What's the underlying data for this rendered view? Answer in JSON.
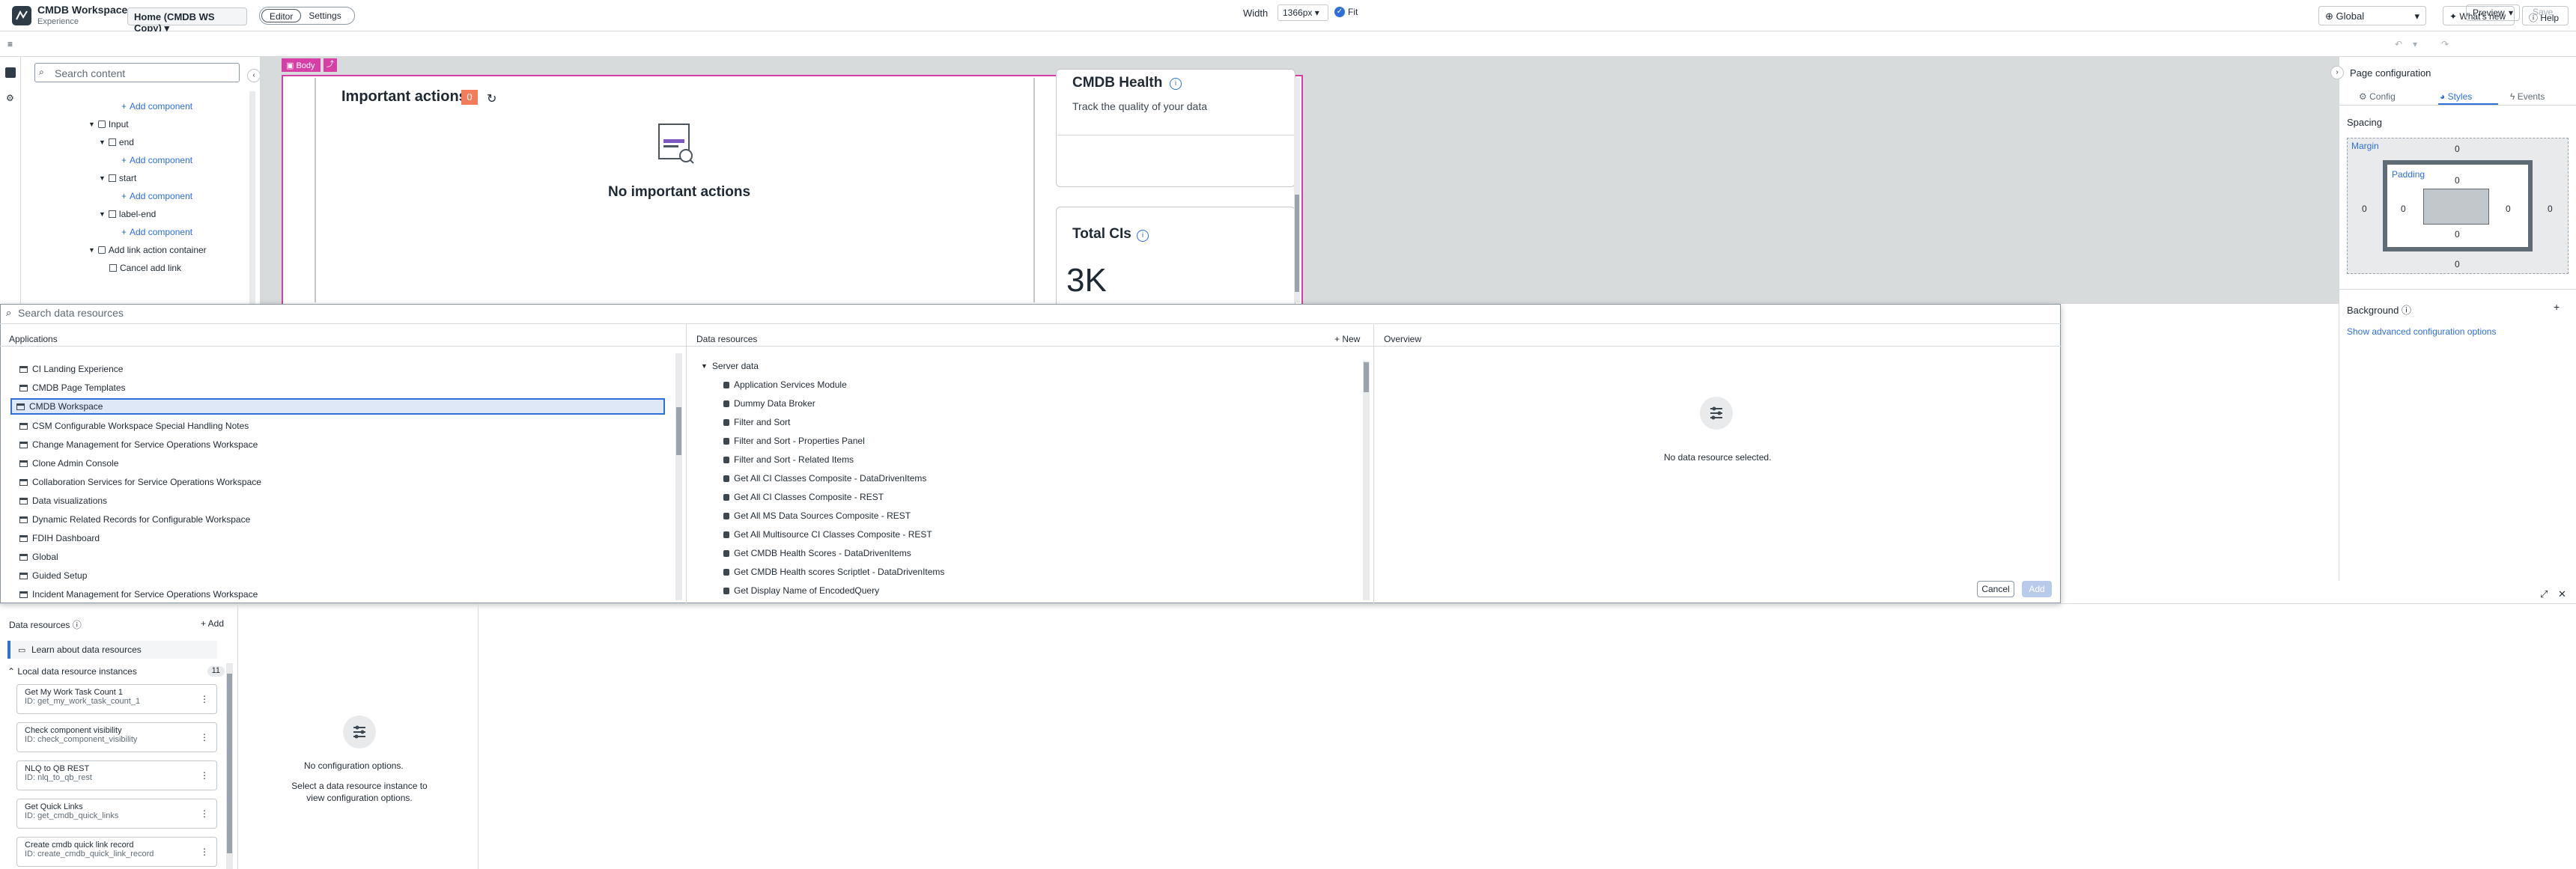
{
  "header": {
    "app_title": "CMDB Workspace",
    "app_subtitle": "Experience",
    "page_select": "Home (CMDB WS Copy)",
    "mode_editor": "Editor",
    "mode_settings": "Settings",
    "scope": "Global",
    "whats_new": "What's new",
    "help": "Help"
  },
  "toolbar": {
    "width_label": "Width",
    "width_value": "1366px",
    "fit_label": "Fit",
    "preview": "Preview",
    "save": "Save"
  },
  "left_panel": {
    "search_placeholder": "Search content",
    "tree": [
      {
        "label": "Add component",
        "kind": "add"
      },
      {
        "label": "Input",
        "kind": "node"
      },
      {
        "label": "end",
        "kind": "leaf"
      },
      {
        "label": "Add component",
        "kind": "add"
      },
      {
        "label": "start",
        "kind": "leaf"
      },
      {
        "label": "Add component",
        "kind": "add"
      },
      {
        "label": "label-end",
        "kind": "leaf"
      },
      {
        "label": "Add component",
        "kind": "add"
      },
      {
        "label": "Add link action container",
        "kind": "node"
      },
      {
        "label": "Cancel add link",
        "kind": "leaf"
      }
    ]
  },
  "canvas": {
    "body_tag": "Body",
    "important_actions_title": "Important actions",
    "important_actions_count": "0",
    "no_important_actions": "No important actions",
    "health_title": "CMDB Health",
    "health_subtitle": "Track the quality of your data",
    "total_cis_title": "Total CIs",
    "total_cis_value": "3K"
  },
  "right_panel": {
    "title": "Page configuration",
    "tabs": [
      "Config",
      "Styles",
      "Events"
    ],
    "active_tab": "Styles",
    "spacing_label": "Spacing",
    "margin_label": "Margin",
    "padding_label": "Padding",
    "margin_values": [
      "0",
      "0",
      "0",
      "0"
    ],
    "padding_values": [
      "0",
      "0",
      "0",
      "0"
    ],
    "background_label": "Background",
    "advanced_link": "Show advanced configuration options"
  },
  "data_modal": {
    "search_placeholder": "Search data resources",
    "applications_header": "Applications",
    "resources_header": "Data resources",
    "new_label": "+ New",
    "overview_header": "Overview",
    "applications": [
      "CI Landing Experience",
      "CMDB Page Templates",
      "CMDB Workspace",
      "CSM Configurable Workspace Special Handling Notes",
      "Change Management for Service Operations Workspace",
      "Clone Admin Console",
      "Collaboration Services for Service Operations Workspace",
      "Data visualizations",
      "Dynamic Related Records for Configurable Workspace",
      "FDIH Dashboard",
      "Global",
      "Guided Setup",
      "Incident Management for Service Operations Workspace"
    ],
    "selected_application": "CMDB Workspace",
    "server_data_label": "Server data",
    "resources": [
      "Application Services Module",
      "Dummy Data Broker",
      "Filter and Sort",
      "Filter and Sort - Properties Panel",
      "Filter and Sort - Related Items",
      "Get All CI Classes Composite - DataDrivenItems",
      "Get All CI Classes Composite - REST",
      "Get All MS Data Sources Composite - REST",
      "Get All Multisource CI Classes Composite - REST",
      "Get CMDB Health Scores - DataDrivenItems",
      "Get CMDB Health scores Scriptlet - DataDrivenItems",
      "Get Display Name of EncodedQuery"
    ],
    "overview_empty": "No data resource selected.",
    "cancel": "Cancel",
    "add": "Add"
  },
  "bottom_panel": {
    "title": "Data resources",
    "add": "+ Add",
    "learn": "Learn about data resources",
    "local_label": "Local data resource instances",
    "local_count": "11",
    "instances": [
      {
        "name": "Get My Work Task Count 1",
        "id": "ID: get_my_work_task_count_1"
      },
      {
        "name": "Check component visibility",
        "id": "ID: check_component_visibility"
      },
      {
        "name": "NLQ to QB REST",
        "id": "ID: nlq_to_qb_rest"
      },
      {
        "name": "Get Quick Links",
        "id": "ID: get_cmdb_quick_links"
      },
      {
        "name": "Create cmdb quick link record",
        "id": "ID: create_cmdb_quick_link_record"
      }
    ],
    "no_config": "No configuration options.",
    "no_config_hint": "Select a data resource instance to view configuration options."
  }
}
